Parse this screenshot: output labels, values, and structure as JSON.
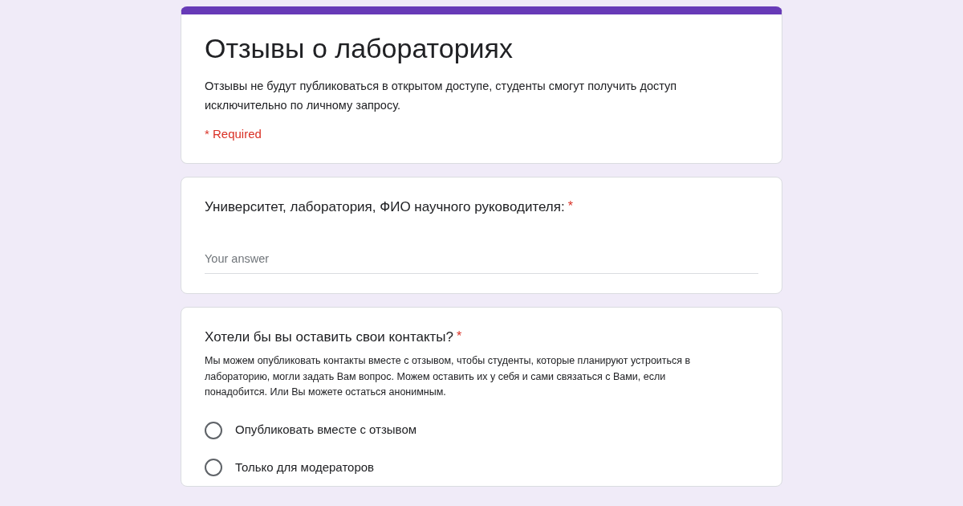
{
  "form": {
    "title": "Отзывы о лабораториях",
    "description": "Отзывы не будут публиковаться в открытом доступе, студенты смогут получить доступ исключительно по личному запросу.",
    "required_note": "* Required"
  },
  "questions": [
    {
      "kind": "text",
      "title": "Университет, лаборатория, ФИО научного руководителя:",
      "required": true,
      "required_mark": "*",
      "placeholder": "Your answer"
    },
    {
      "kind": "radio",
      "title": "Хотели бы вы оставить свои контакты?",
      "required": true,
      "required_mark": "*",
      "description": "Мы можем опубликовать контакты вместе с отзывом, чтобы студенты, которые планируют устроиться в лабораторию, могли задать Вам вопрос. Можем оставить их у себя и сами связаться с Вами, если понадобится. Или Вы можете остаться анонимным.",
      "options": [
        {
          "label": "Опубликовать вместе с отзывом",
          "selected": false
        },
        {
          "label": "Только для модераторов",
          "selected": false
        }
      ]
    }
  ]
}
